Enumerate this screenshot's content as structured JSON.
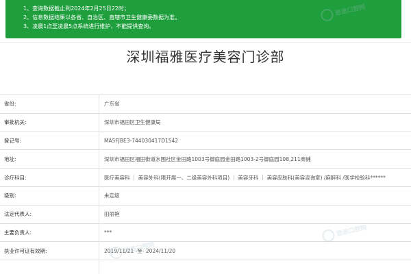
{
  "notice": {
    "lines": [
      "1、查询数据截止到2024年2月25日22时；",
      "2、信息数据结果以各省、自治区、直辖市卫生健康委数据为准。",
      "3、凌晨1点至凌晨5点系统进行维护，不能提供查询。"
    ]
  },
  "title": "深圳福雅医疗美容门诊部",
  "rows": [
    {
      "label": "省份:",
      "value": "广东省"
    },
    {
      "label": "审批机关:",
      "value": "深圳市福田区卫生健康局"
    },
    {
      "label": "登记号:",
      "value": "MA5FJBE3-744030417D1542"
    },
    {
      "label": "地址:",
      "value": "深圳市福田区福田街道水围社区金田路1003号御庭园金田路1003-2号御庭园108,211商铺"
    },
    {
      "label": "诊疗科目:",
      "value": "医疗美容科 ｜ 美容外科(限开展一、二级美容外科项目) ｜ 美容牙科 ｜ 美容皮肤科(美容咨询室) /麻醉科 /医学检验科******"
    },
    {
      "label": "级别:",
      "value": "未定级"
    },
    {
      "label": "法定代表人:",
      "value": "田丽艳"
    },
    {
      "label": "主要负责人:",
      "value": "***"
    },
    {
      "label": "执业许可证有效期:",
      "value": "2019/11/21 -至- 2024/11/20"
    }
  ],
  "watermark": {
    "text": "途途口腔网"
  }
}
